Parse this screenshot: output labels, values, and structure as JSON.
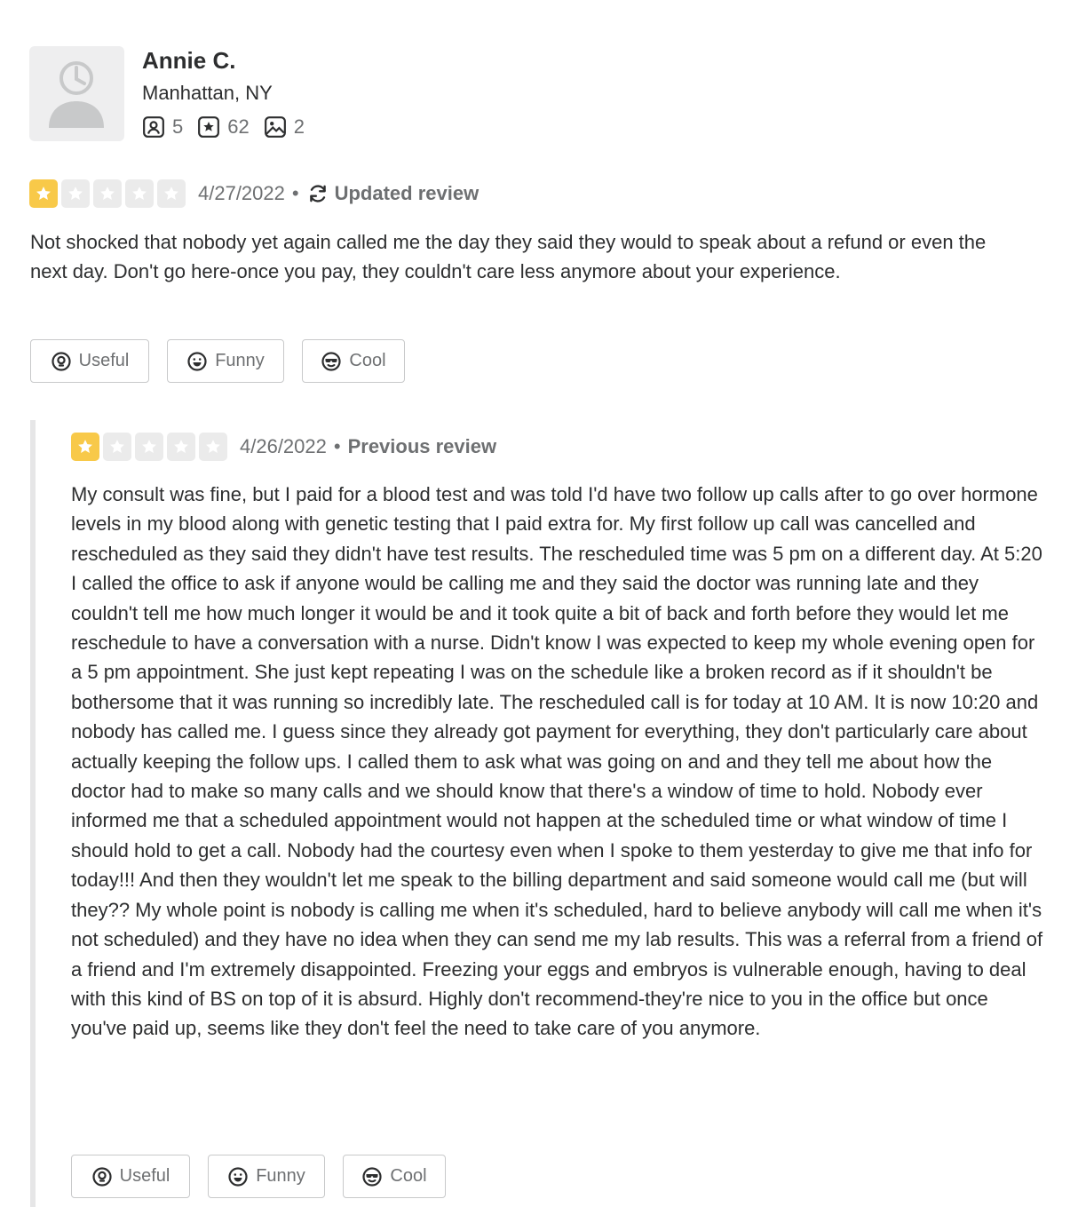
{
  "user": {
    "name": "Annie C.",
    "location": "Manhattan, NY",
    "stats": {
      "friends": "5",
      "reviews": "62",
      "photos": "2"
    },
    "icons": [
      "avatar-placeholder",
      "friends-icon",
      "star-icon",
      "photo-icon"
    ]
  },
  "updated_review": {
    "rating": 1,
    "date": "4/27/2022",
    "separator": "•",
    "status": "Updated review",
    "text": "Not shocked that nobody yet again called me the day they said they would to speak about a refund or even the next day.  Don't go here-once you pay, they couldn't care less anymore about your experience.",
    "buttons": {
      "useful": "Useful",
      "funny": "Funny",
      "cool": "Cool"
    }
  },
  "previous_review": {
    "rating": 1,
    "date": "4/26/2022",
    "separator": "•",
    "status": "Previous review",
    "text": "My consult was fine, but I paid for a blood test and was told I'd have two follow up calls after to go over hormone levels in my blood along with genetic testing that I paid extra for.  My first follow up call was cancelled and rescheduled as they said they didn't have test results.  The rescheduled time was 5 pm on a different day.  At 5:20 I called the office to ask if anyone would be calling me and they said the doctor was running late and they couldn't tell me how much longer it would be and it took quite a bit of back and forth before they would let me reschedule to have a conversation with a nurse.  Didn't know I was expected to keep my whole evening open for a 5 pm appointment.  She just kept repeating I was on the schedule like a broken record as if it shouldn't be bothersome that it was running so incredibly late.  The rescheduled call is for today at 10 AM.  It is now 10:20 and nobody has called me.  I guess since they already got payment for everything, they don't particularly care about actually keeping the follow ups.  I called them to ask what was going on and and they tell me about how the doctor had to make so many calls and we should know that there's a window of time to hold.  Nobody ever informed me that a scheduled appointment would not happen at the scheduled time or what window of time I should hold to get a call.  Nobody had the courtesy even when I spoke to them yesterday to give me that info for today!!! And then they wouldn't let me speak to the billing department and said someone would call me (but will they?? My whole point is nobody is calling me when it's scheduled, hard to believe anybody will call me when it's not scheduled) and they have no idea when they can send me my lab results.  This was a referral from a friend of a friend and I'm extremely disappointed.  Freezing your eggs and embryos is vulnerable enough, having to deal with this kind of BS on top of it is absurd.  Highly don't recommend-they're nice to you in the office but once you've paid up, seems like they don't feel the need to take care of you anymore.",
    "buttons": {
      "useful": "Useful",
      "funny": "Funny",
      "cool": "Cool"
    }
  },
  "colors": {
    "star_on": "#f8c949",
    "star_off": "#ebebeb",
    "text": "#2d2e2f",
    "muted": "#6e7072",
    "border": "#c8c9ca"
  }
}
